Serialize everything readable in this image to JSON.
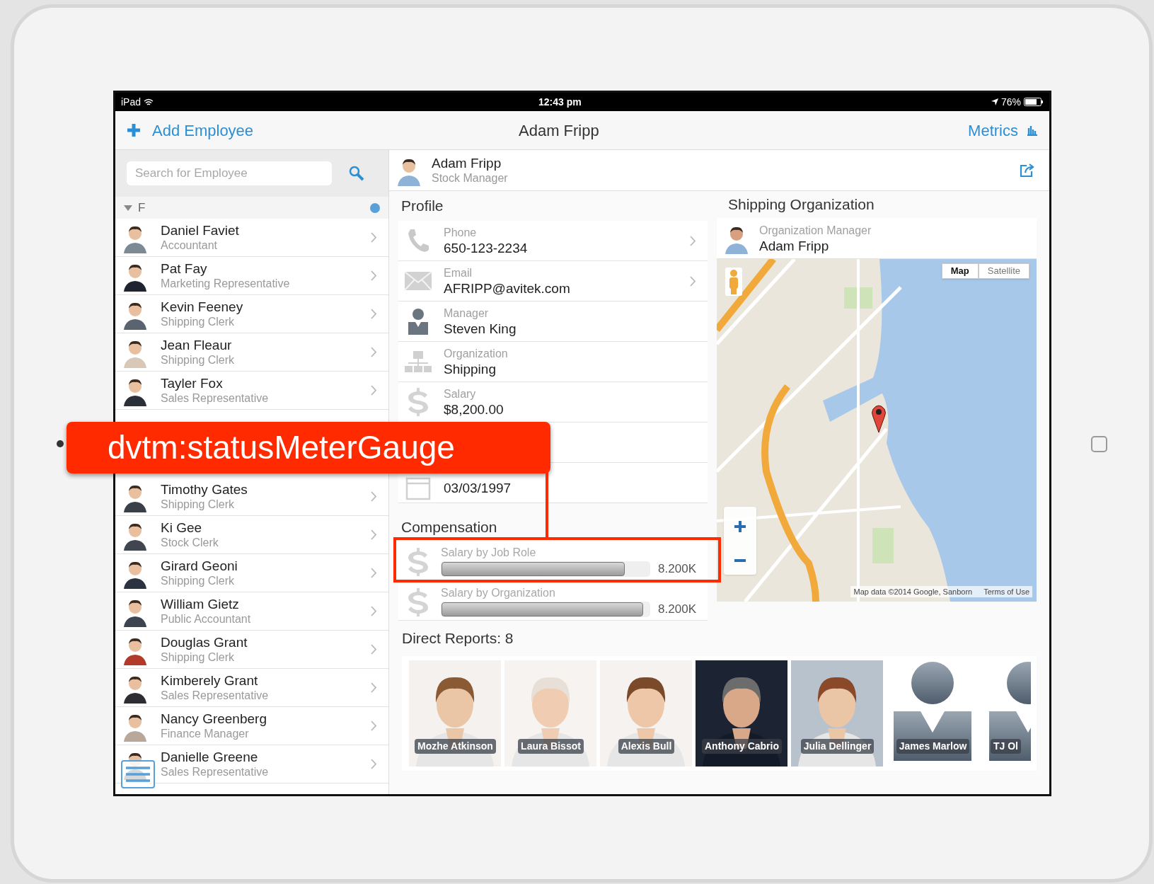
{
  "status_bar": {
    "device": "iPad",
    "time": "12:43 pm",
    "battery": "76%"
  },
  "nav_bar": {
    "add_button": "Add Employee",
    "title": "Adam Fripp",
    "metrics_button": "Metrics"
  },
  "search": {
    "placeholder": "Search for Employee"
  },
  "employee_list": [
    {
      "header": "F",
      "expanded": true,
      "employees": [
        {
          "name": "Daniel Faviet",
          "title": "Accountant"
        },
        {
          "name": "Pat Fay",
          "title": "Marketing Representative"
        },
        {
          "name": "Kevin Feeney",
          "title": "Shipping Clerk"
        },
        {
          "name": "Jean Fleaur",
          "title": "Shipping Clerk"
        },
        {
          "name": "Tayler Fox",
          "title": "Sales Representative"
        }
      ]
    },
    {
      "employees": [
        {
          "name": "Timothy Gates",
          "title": "Shipping Clerk"
        },
        {
          "name": "Ki Gee",
          "title": "Stock Clerk"
        },
        {
          "name": "Girard Geoni",
          "title": "Shipping Clerk"
        },
        {
          "name": "William Gietz",
          "title": "Public Accountant"
        },
        {
          "name": "Douglas Grant",
          "title": "Shipping Clerk"
        },
        {
          "name": "Kimberely Grant",
          "title": "Sales Representative"
        },
        {
          "name": "Nancy Greenberg",
          "title": "Finance Manager"
        },
        {
          "name": "Danielle Greene",
          "title": "Sales Representative"
        }
      ]
    }
  ],
  "employee_card": {
    "name": "Adam Fripp",
    "title": "Stock Manager"
  },
  "profile": {
    "title": "Profile",
    "fields": [
      {
        "kind": "phone",
        "label": "Phone",
        "value": "650-123-2234",
        "link": true
      },
      {
        "kind": "email",
        "label": "Email",
        "value": "AFRIPP@avitek.com",
        "link": true
      },
      {
        "kind": "manager",
        "label": "Manager",
        "value": "Steven King",
        "link": false
      },
      {
        "kind": "organization",
        "label": "Organization",
        "value": "Shipping",
        "link": false
      },
      {
        "kind": "salary",
        "label": "Salary",
        "value": "$8,200.00",
        "link": false
      },
      {
        "kind": "date",
        "value": "03/03/1997",
        "link": false
      }
    ]
  },
  "compensation": {
    "title": "Compensation",
    "meters": [
      {
        "label": "Salary by Job Role",
        "level": 0.88,
        "reading": "8.200K"
      },
      {
        "label": "Salary by Organization",
        "level": 0.97,
        "reading": "8.200K"
      }
    ]
  },
  "shipping_organization": {
    "title": "Shipping Organization",
    "manager_label": "Organization Manager",
    "manager_name": "Adam Fripp",
    "map": {
      "kind": "picture",
      "types": [
        {
          "label": "Map",
          "selected": true
        },
        {
          "label": "Satellite",
          "selected": false
        }
      ],
      "attribution": "Map data ©2014 Google, Sanborn",
      "terms": "Terms of Use"
    }
  },
  "direct_reports": {
    "title": "Direct Reports: 8",
    "people": [
      {
        "name": "Mozhe Atkinson"
      },
      {
        "name": "Laura Bissot"
      },
      {
        "name": "Alexis Bull"
      },
      {
        "name": "Anthony Cabrio"
      },
      {
        "name": "Julia Dellinger"
      },
      {
        "name": "James Marlow",
        "kind": "silhouette"
      },
      {
        "name": "TJ Ol",
        "kind": "silhouette"
      }
    ]
  },
  "annotation": {
    "text": "dvtm:statusMeterGauge"
  }
}
